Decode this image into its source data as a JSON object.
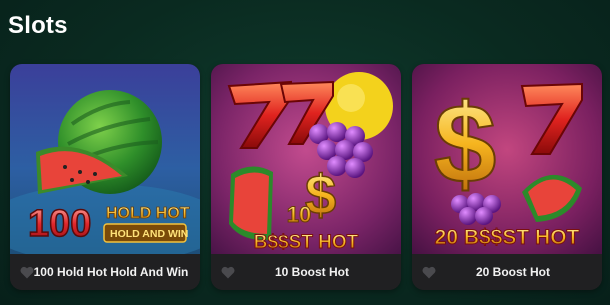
{
  "section": {
    "title": "Slots"
  },
  "games": [
    {
      "name": "100 Hold Hot Hold And Win",
      "logo_number": "100",
      "logo_line1": "HOLD HOT",
      "logo_line2": "HOLD AND WIN"
    },
    {
      "name": "10 Boost Hot",
      "logo_number": "10",
      "logo_line1": "B$$ST HOT"
    },
    {
      "name": "20 Boost Hot",
      "logo_line1": "20 B$$ST HOT"
    }
  ],
  "icons": {
    "favorite": "heart-icon"
  },
  "colors": {
    "background": "#0a2a20",
    "card_footer": "#202022",
    "heart": "#4a4a4e"
  }
}
